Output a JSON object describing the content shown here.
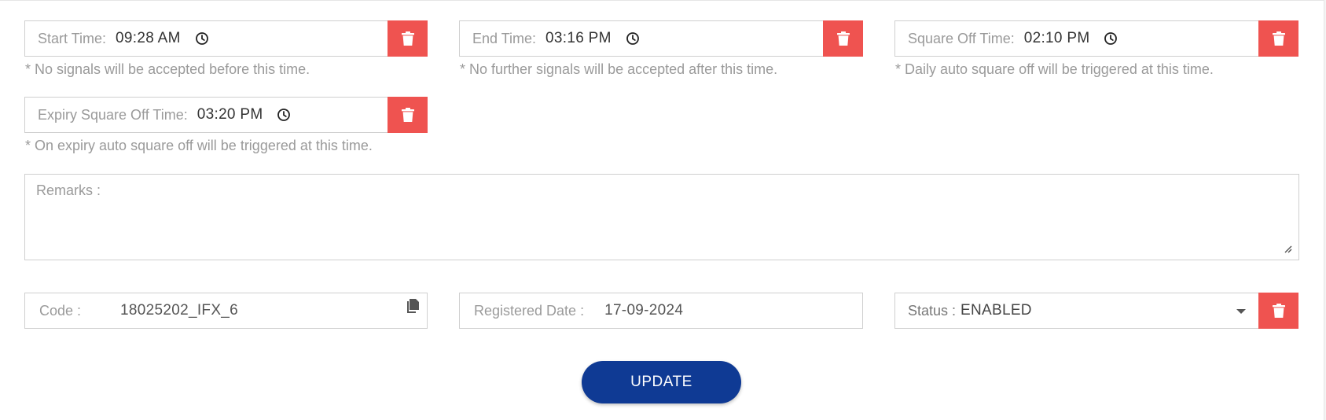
{
  "start_time": {
    "label": "Start Time:",
    "value": "09:28 AM",
    "hint": "* No signals will be accepted before this time."
  },
  "end_time": {
    "label": "End Time:",
    "value": "03:16 PM",
    "hint": "* No further signals will be accepted after this time."
  },
  "square_off_time": {
    "label": "Square Off Time:",
    "value": "02:10 PM",
    "hint": "* Daily auto square off will be triggered at this time."
  },
  "expiry_square_off_time": {
    "label": "Expiry Square Off Time:",
    "value": "03:20 PM",
    "hint": "* On expiry auto square off will be triggered at this time."
  },
  "remarks": {
    "placeholder": "Remarks :"
  },
  "code": {
    "label": "Code :",
    "value": "18025202_IFX_6"
  },
  "registered_date": {
    "label": "Registered Date :",
    "value": "17-09-2024"
  },
  "status": {
    "label": "Status :",
    "value": "ENABLED"
  },
  "update_button": {
    "label": "UPDATE"
  },
  "colors": {
    "danger": "#ef5350",
    "primary": "#0f3a94"
  },
  "icons": {
    "clock": "clock-icon",
    "trash": "trash-icon",
    "copy": "copy-icon",
    "caret": "chevron-down-icon"
  }
}
